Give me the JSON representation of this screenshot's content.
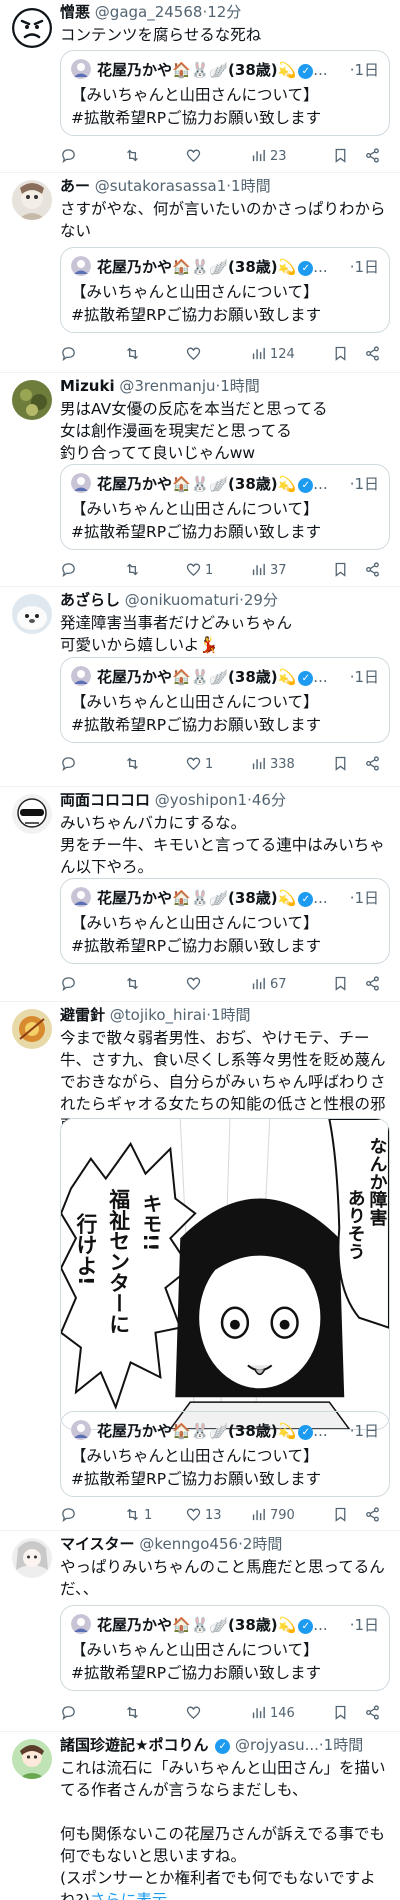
{
  "quote": {
    "name": "花屋乃かや🏠🐰🪽(38歳)💫",
    "dots": "...",
    "time": "·1日",
    "text": "【みいちゃんと山田さんについて】\n#拡散希望RPご協力お願い致します"
  },
  "tweets": [
    {
      "name": "憎悪",
      "handle": "@gaga_24568",
      "time": "·12分",
      "text": "コンテンツを腐らせるな死ね",
      "stats": {
        "reply": "",
        "retweet": "",
        "like": "",
        "views": "23"
      }
    },
    {
      "name": "あー",
      "handle": "@sutakorasassa1",
      "time": "·1時間",
      "text": "さすがやな、何が言いたいのかさっぱりわからない",
      "stats": {
        "reply": "",
        "retweet": "",
        "like": "",
        "views": "124"
      }
    },
    {
      "name": "Mizuki",
      "handle": "@3renmanju",
      "time": "·1時間",
      "text": "男はAV女優の反応を本当だと思ってる\n女は創作漫画を現実だと思ってる\n釣り合ってて良いじゃんww",
      "stats": {
        "reply": "",
        "retweet": "",
        "like": "1",
        "views": "37"
      }
    },
    {
      "name": "あざらし",
      "handle": "@onikuomaturi",
      "time": "·29分",
      "text": "発達障害当事者だけどみぃちゃん\n可愛いから嬉しいよ💃",
      "stats": {
        "reply": "",
        "retweet": "",
        "like": "1",
        "views": "338"
      }
    },
    {
      "name": "両面コロコロ",
      "handle": "@yoshipon1",
      "time": "·46分",
      "text": "みいちゃんバカにするな。\n男をチー牛、キモいと言ってる連中はみいちゃん以下やろ。",
      "stats": {
        "reply": "",
        "retweet": "",
        "like": "",
        "views": "67"
      }
    },
    {
      "name": "避雷針",
      "handle": "@tojiko_hirai",
      "time": "·1時間",
      "text": "今まで散々弱者男性、おぢ、やけモテ、チー牛、さす九、食い尽くし系等々男性を貶め蔑んでおきながら、自分らがみぃちゃん呼ばわりされたらギャオる女たちの知能の低さと性根の邪悪さは正にみぃちゃんそのもの",
      "stats": {
        "reply": "",
        "retweet": "1",
        "like": "13",
        "views": "790"
      },
      "image": {
        "bubble_left_1": "キモ!!",
        "bubble_left_2": "福祉センターに",
        "bubble_left_3": "行けよ!",
        "bubble_right_1": "なんか障害",
        "bubble_right_2": "ありそう"
      }
    },
    {
      "name": "マイスター",
      "handle": "@kenngo456",
      "time": "·2時間",
      "text": "やっぱりみいちゃんのこと馬鹿だと思ってるんだ、、",
      "stats": {
        "reply": "",
        "retweet": "",
        "like": "",
        "views": "146"
      }
    },
    {
      "name": "諸国珍遊記★ポコりん",
      "handle": "@rojyasu...",
      "time": "·1時間",
      "text": "これは流石に「みいちゃんと山田さん」を描いてる作者さんが言うならまだしも、\n\n何も関係ないこの花屋乃さんが訴えでる事でも何でもないと思いますね。\n(スポンサーとか権利者でも何でもないですよね?)",
      "more": "さらに表示"
    }
  ],
  "colors": {
    "link": "#1d9bf0",
    "secondary": "#536471",
    "border": "#cfd9de"
  }
}
